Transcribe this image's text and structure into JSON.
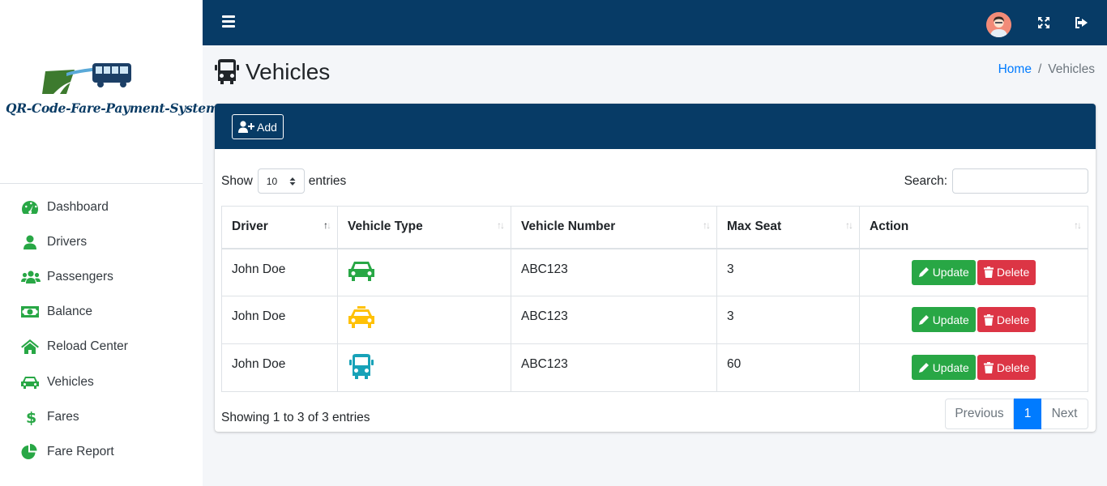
{
  "sidebar": {
    "logo_text": "QR-Code-Fare-Payment-System",
    "items": [
      {
        "label": "Dashboard",
        "icon": "dashboard-gauge-icon"
      },
      {
        "label": "Drivers",
        "icon": "user-icon"
      },
      {
        "label": "Passengers",
        "icon": "users-icon"
      },
      {
        "label": "Balance",
        "icon": "money-bill-icon"
      },
      {
        "label": "Reload Center",
        "icon": "home-icon"
      },
      {
        "label": "Vehicles",
        "icon": "car-icon"
      },
      {
        "label": "Fares",
        "icon": "dollar-icon"
      },
      {
        "label": "Fare Report",
        "icon": "pie-chart-icon"
      }
    ]
  },
  "header": {
    "menu_icon": "hamburger-icon",
    "fullscreen_icon": "expand-icon",
    "logout_icon": "sign-out-icon"
  },
  "page": {
    "title": "Vehicles",
    "title_icon": "bus-icon",
    "breadcrumb": {
      "home": "Home",
      "separator": "/",
      "current": "Vehicles"
    }
  },
  "card": {
    "add_label": "Add",
    "length": {
      "prefix": "Show",
      "value": "10",
      "suffix": "entries"
    },
    "search_label": "Search:",
    "search_value": "",
    "columns": [
      "Driver",
      "Vehicle Type",
      "Vehicle Number",
      "Max Seat",
      "Action"
    ],
    "rows": [
      {
        "driver": "John Doe",
        "type_icon": "car-icon",
        "type_color": "#28a745",
        "number": "ABC123",
        "seats": "3"
      },
      {
        "driver": "John Doe",
        "type_icon": "taxi-icon",
        "type_color": "#ffc107",
        "number": "ABC123",
        "seats": "3"
      },
      {
        "driver": "John Doe",
        "type_icon": "bus-icon",
        "type_color": "#17a2b8",
        "number": "ABC123",
        "seats": "60"
      }
    ],
    "update_label": "Update",
    "delete_label": "Delete",
    "info": "Showing 1 to 3 of 3 entries",
    "pagination": {
      "previous": "Previous",
      "current": "1",
      "next": "Next"
    }
  },
  "colors": {
    "navbar": "#073b66",
    "accent_green": "#28a745",
    "danger": "#dc3545",
    "primary": "#007bff"
  }
}
